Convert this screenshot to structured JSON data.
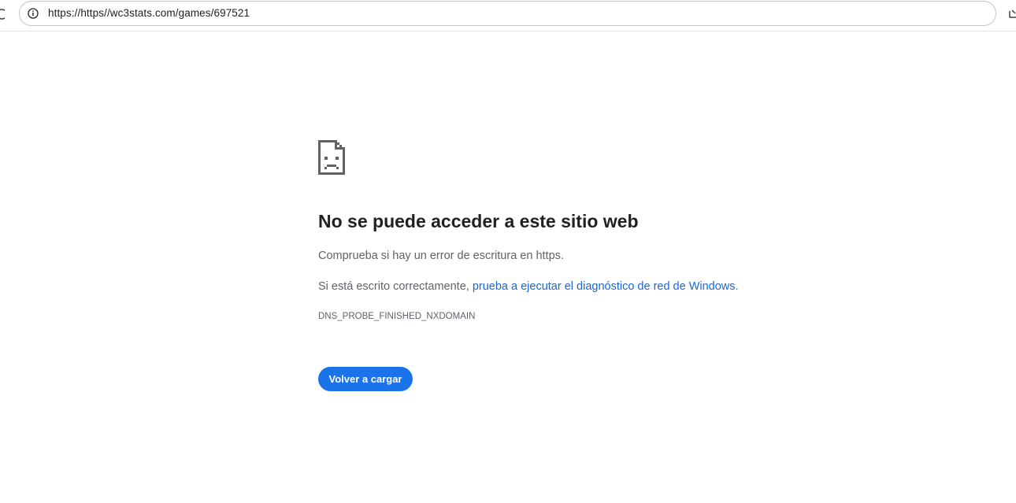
{
  "browser": {
    "url": "https://https//wc3stats.com/games/697521",
    "icons": {
      "left": "reload-icon",
      "site_info": "info-icon",
      "right": "download-icon"
    }
  },
  "error_page": {
    "icon": "sad-page-icon",
    "headline": "No se puede acceder a este sitio web",
    "message": "Comprueba si hay un error de escritura en https.",
    "suggestion_prefix": "Si está escrito correctamente, ",
    "suggestion_link": "prueba a ejecutar el diagnóstico de red de Windows",
    "suggestion_suffix": ".",
    "error_code": "DNS_PROBE_FINISHED_NXDOMAIN",
    "reload_button": "Volver a cargar"
  },
  "colors": {
    "link": "#1967d2",
    "button": "#1a73e8",
    "headline": "#202124",
    "body_text": "#5f6368"
  }
}
